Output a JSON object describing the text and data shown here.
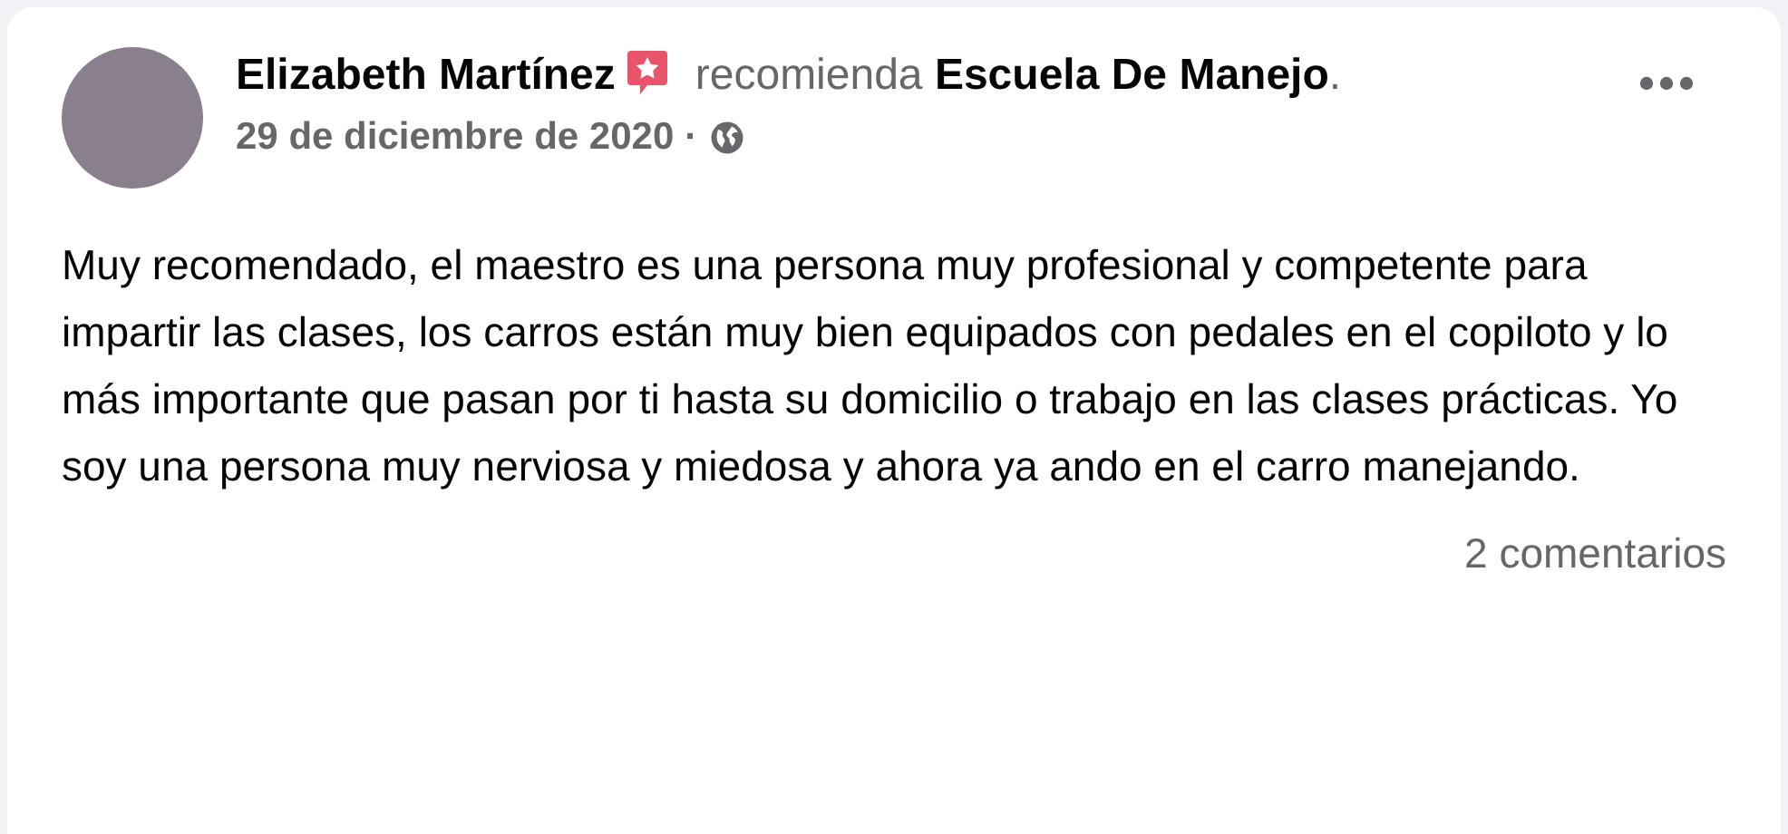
{
  "post": {
    "author": "Elizabeth Martínez",
    "action": "recomienda **Escuela De Manejo**.",
    "date": "29 de diciembre de 2020",
    "separator": "·",
    "body": "Muy recomendado, el maestro es una persona muy profesional y competente para impartir las clases, los carros están muy bien equipados con pedales en el copiloto y lo más importante que pasan por ti hasta su domicilio o trabajo en las clases prácticas. Yo soy una persona muy nerviosa y miedosa y ahora ya ando en el carro manejando.",
    "comments": "2 comentarios"
  }
}
